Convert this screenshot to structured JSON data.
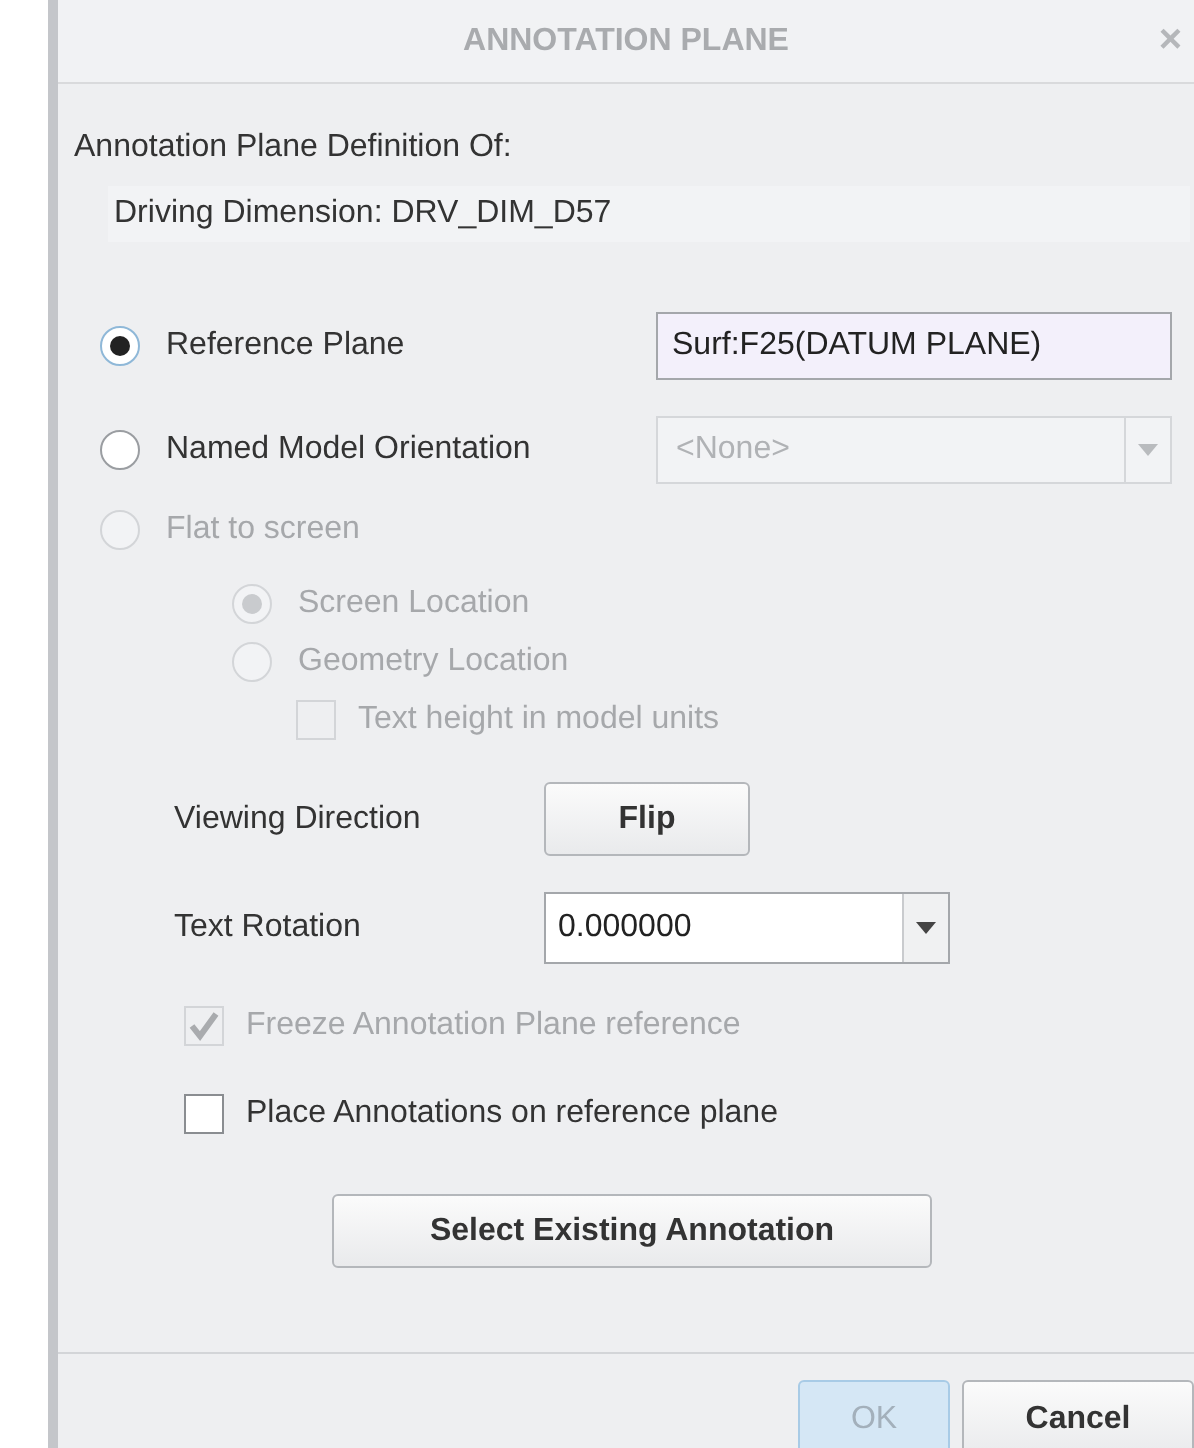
{
  "window": {
    "title": "ANNOTATION PLANE",
    "close": "×"
  },
  "definition": {
    "label": "Annotation Plane Definition Of:",
    "value": "Driving Dimension: DRV_DIM_D57"
  },
  "plane_options": [
    {
      "kind": "field",
      "label": "Reference Plane",
      "selected": true,
      "disabled": false,
      "value": "Surf:F25(DATUM PLANE)"
    },
    {
      "kind": "dropdown",
      "label": "Named Model Orientation",
      "selected": false,
      "disabled": false,
      "value": "<None>"
    },
    {
      "kind": "plain",
      "label": "Flat to screen",
      "selected": false,
      "disabled": true
    }
  ],
  "location_options": [
    {
      "label": "Screen Location",
      "selected": true,
      "disabled": true
    },
    {
      "label": "Geometry Location",
      "selected": false,
      "disabled": true
    }
  ],
  "text_height": {
    "label": "Text height in model units",
    "checked": false,
    "disabled": true
  },
  "viewing_direction": {
    "label": "Viewing Direction",
    "button": "Flip"
  },
  "text_rotation": {
    "label": "Text Rotation",
    "value": "0.000000"
  },
  "freeze": {
    "label": "Freeze Annotation Plane reference",
    "checked": true,
    "disabled": true
  },
  "place": {
    "label": "Place Annotations on reference plane",
    "checked": false,
    "disabled": false
  },
  "select_button": "Select Existing Annotation",
  "buttons": [
    {
      "label": "OK",
      "kind": "default",
      "disabled": true
    },
    {
      "label": "Cancel",
      "kind": "normal",
      "disabled": false
    }
  ]
}
